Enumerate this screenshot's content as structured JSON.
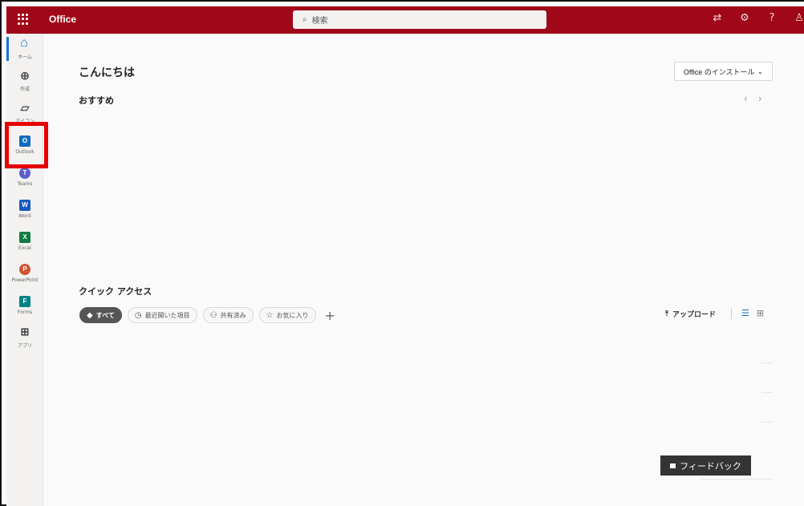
{
  "header": {
    "app_name": "Office",
    "search_placeholder": "検索",
    "icons": [
      "grid-icon",
      "feedback-sync-icon",
      "settings-icon",
      "help-icon",
      "user-icon"
    ],
    "help_label": "?"
  },
  "sidebar": {
    "items": [
      {
        "label": "ホーム",
        "icon": "home-icon"
      },
      {
        "label": "作成",
        "icon": "create-icon"
      },
      {
        "label": "マイコン",
        "icon": "folder-icon"
      },
      {
        "label": "Outlook",
        "icon": "outlook-icon"
      },
      {
        "label": "Teams",
        "icon": "teams-icon"
      },
      {
        "label": "Word",
        "icon": "word-icon"
      },
      {
        "label": "Excel",
        "icon": "excel-icon"
      },
      {
        "label": "PowerPoint",
        "icon": "powerpoint-icon"
      },
      {
        "label": "Forms",
        "icon": "forms-icon"
      },
      {
        "label": "アプリ",
        "icon": "apps-icon"
      }
    ],
    "highlighted_item": "Outlook"
  },
  "main": {
    "greeting": "こんにちは",
    "install_button": "Office のインストール",
    "recommended_title": "おすすめ",
    "quick_access_title": "クイック アクセス",
    "filters": [
      "すべて",
      "最近開いた項目",
      "共有済み",
      "お気に入り"
    ],
    "add_filter": "+",
    "upload_label": "アップロード",
    "feedback_label": "フィードバック"
  },
  "colors": {
    "header": "#a00718",
    "highlight": "#e60000",
    "accent_blue": "#1a73d6",
    "feedback": "#343434"
  }
}
